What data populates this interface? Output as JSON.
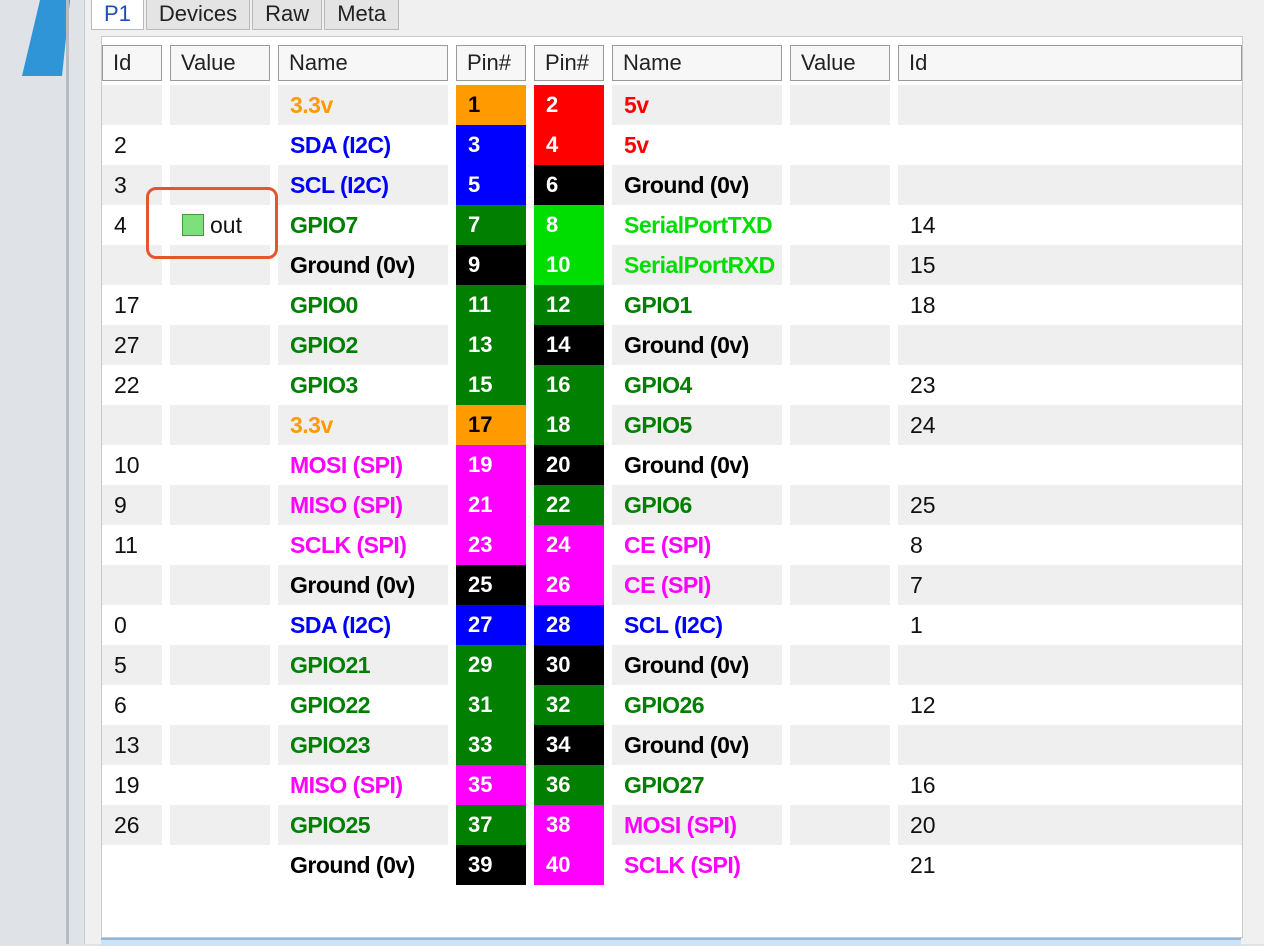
{
  "tabs": [
    {
      "label": "P1",
      "active": true
    },
    {
      "label": "Devices",
      "active": false
    },
    {
      "label": "Raw",
      "active": false
    },
    {
      "label": "Meta",
      "active": false
    }
  ],
  "headers": {
    "left_id": "Id",
    "left_value": "Value",
    "left_name": "Name",
    "left_pin": "Pin#",
    "right_pin": "Pin#",
    "right_name": "Name",
    "right_value": "Value",
    "right_id": "Id"
  },
  "colors": {
    "orange": "#ff9a00",
    "red": "#ff0000",
    "blue": "#0000ff",
    "black": "#000000",
    "green": "#007f00",
    "lime": "#00dd00",
    "magenta": "#ff00ff",
    "highlight": "#e4572e"
  },
  "rows": [
    {
      "left_id": "",
      "left_value": "",
      "left_name": "3.3v",
      "left_color": "orange",
      "left_pin": "1",
      "right_pin": "2",
      "right_name": "5v",
      "right_color": "red",
      "right_value": "",
      "right_id": ""
    },
    {
      "left_id": "2",
      "left_value": "",
      "left_name": "SDA (I2C)",
      "left_color": "blue",
      "left_pin": "3",
      "right_pin": "4",
      "right_name": "5v",
      "right_color": "red",
      "right_value": "",
      "right_id": ""
    },
    {
      "left_id": "3",
      "left_value": "",
      "left_name": "SCL (I2C)",
      "left_color": "blue",
      "left_pin": "5",
      "right_pin": "6",
      "right_name": "Ground (0v)",
      "right_color": "black",
      "right_value": "",
      "right_id": ""
    },
    {
      "left_id": "4",
      "left_value": "out",
      "left_name": "GPIO7",
      "left_color": "green",
      "left_pin": "7",
      "right_pin": "8",
      "right_name": "SerialPortTXD",
      "right_color": "lime",
      "right_value": "",
      "right_id": "14"
    },
    {
      "left_id": "",
      "left_value": "",
      "left_name": "Ground (0v)",
      "left_color": "black",
      "left_pin": "9",
      "right_pin": "10",
      "right_name": "SerialPortRXD",
      "right_color": "lime",
      "right_value": "",
      "right_id": "15"
    },
    {
      "left_id": "17",
      "left_value": "",
      "left_name": "GPIO0",
      "left_color": "green",
      "left_pin": "11",
      "right_pin": "12",
      "right_name": "GPIO1",
      "right_color": "green",
      "right_value": "",
      "right_id": "18"
    },
    {
      "left_id": "27",
      "left_value": "",
      "left_name": "GPIO2",
      "left_color": "green",
      "left_pin": "13",
      "right_pin": "14",
      "right_name": "Ground (0v)",
      "right_color": "black",
      "right_value": "",
      "right_id": ""
    },
    {
      "left_id": "22",
      "left_value": "",
      "left_name": "GPIO3",
      "left_color": "green",
      "left_pin": "15",
      "right_pin": "16",
      "right_name": "GPIO4",
      "right_color": "green",
      "right_value": "",
      "right_id": "23"
    },
    {
      "left_id": "",
      "left_value": "",
      "left_name": "3.3v",
      "left_color": "orange",
      "left_pin": "17",
      "right_pin": "18",
      "right_name": "GPIO5",
      "right_color": "green",
      "right_value": "",
      "right_id": "24"
    },
    {
      "left_id": "10",
      "left_value": "",
      "left_name": "MOSI (SPI)",
      "left_color": "magenta",
      "left_pin": "19",
      "right_pin": "20",
      "right_name": "Ground (0v)",
      "right_color": "black",
      "right_value": "",
      "right_id": ""
    },
    {
      "left_id": "9",
      "left_value": "",
      "left_name": "MISO (SPI)",
      "left_color": "magenta",
      "left_pin": "21",
      "right_pin": "22",
      "right_name": "GPIO6",
      "right_color": "green",
      "right_value": "",
      "right_id": "25"
    },
    {
      "left_id": "11",
      "left_value": "",
      "left_name": "SCLK (SPI)",
      "left_color": "magenta",
      "left_pin": "23",
      "right_pin": "24",
      "right_name": "CE (SPI)",
      "right_color": "magenta",
      "right_value": "",
      "right_id": "8"
    },
    {
      "left_id": "",
      "left_value": "",
      "left_name": "Ground (0v)",
      "left_color": "black",
      "left_pin": "25",
      "right_pin": "26",
      "right_name": "CE (SPI)",
      "right_color": "magenta",
      "right_value": "",
      "right_id": "7"
    },
    {
      "left_id": "0",
      "left_value": "",
      "left_name": "SDA (I2C)",
      "left_color": "blue",
      "left_pin": "27",
      "right_pin": "28",
      "right_name": "SCL (I2C)",
      "right_color": "blue",
      "right_value": "",
      "right_id": "1"
    },
    {
      "left_id": "5",
      "left_value": "",
      "left_name": "GPIO21",
      "left_color": "green",
      "left_pin": "29",
      "right_pin": "30",
      "right_name": "Ground (0v)",
      "right_color": "black",
      "right_value": "",
      "right_id": ""
    },
    {
      "left_id": "6",
      "left_value": "",
      "left_name": "GPIO22",
      "left_color": "green",
      "left_pin": "31",
      "right_pin": "32",
      "right_name": "GPIO26",
      "right_color": "green",
      "right_value": "",
      "right_id": "12"
    },
    {
      "left_id": "13",
      "left_value": "",
      "left_name": "GPIO23",
      "left_color": "green",
      "left_pin": "33",
      "right_pin": "34",
      "right_name": "Ground (0v)",
      "right_color": "black",
      "right_value": "",
      "right_id": ""
    },
    {
      "left_id": "19",
      "left_value": "",
      "left_name": "MISO (SPI)",
      "left_color": "magenta",
      "left_pin": "35",
      "right_pin": "36",
      "right_name": "GPIO27",
      "right_color": "green",
      "right_value": "",
      "right_id": "16"
    },
    {
      "left_id": "26",
      "left_value": "",
      "left_name": "GPIO25",
      "left_color": "green",
      "left_pin": "37",
      "right_pin": "38",
      "right_name": "MOSI (SPI)",
      "right_color": "magenta",
      "right_value": "",
      "right_id": "20"
    },
    {
      "left_id": "",
      "left_value": "",
      "left_name": "Ground (0v)",
      "left_color": "black",
      "left_pin": "39",
      "right_pin": "40",
      "right_name": "SCLK (SPI)",
      "right_color": "magenta",
      "right_value": "",
      "right_id": "21"
    }
  ]
}
